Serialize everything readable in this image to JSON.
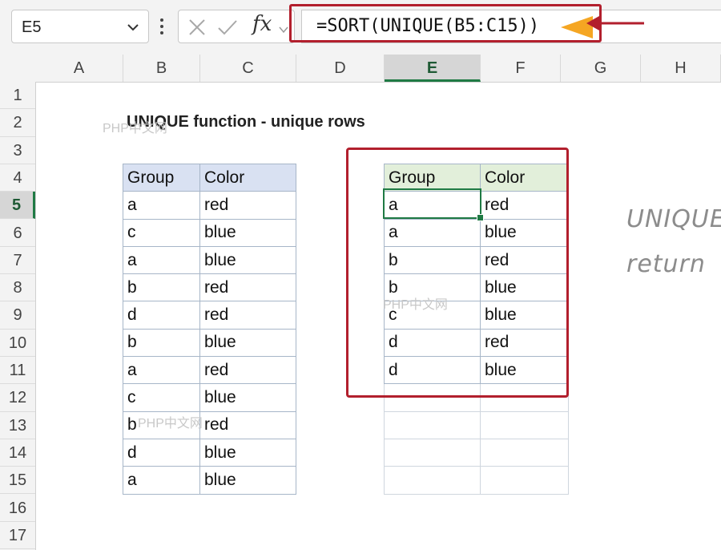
{
  "formula_bar": {
    "name_box": "E5",
    "formula": "=SORT(UNIQUE(B5:C15))",
    "fx_label": "fx"
  },
  "columns": [
    "A",
    "B",
    "C",
    "D",
    "E",
    "F",
    "G",
    "H"
  ],
  "selected_column": "E",
  "rows": [
    "1",
    "2",
    "3",
    "4",
    "5",
    "6",
    "7",
    "8",
    "9",
    "10",
    "11",
    "12",
    "13",
    "14",
    "15",
    "16",
    "17"
  ],
  "selected_row": "5",
  "sheet": {
    "title": "UNIQUE function - unique rows",
    "source_table": {
      "headers": [
        "Group",
        "Color"
      ],
      "rows": [
        [
          "a",
          "red"
        ],
        [
          "c",
          "blue"
        ],
        [
          "a",
          "blue"
        ],
        [
          "b",
          "red"
        ],
        [
          "d",
          "red"
        ],
        [
          "b",
          "blue"
        ],
        [
          "a",
          "red"
        ],
        [
          "c",
          "blue"
        ],
        [
          "b",
          "red"
        ],
        [
          "d",
          "blue"
        ],
        [
          "a",
          "blue"
        ]
      ]
    },
    "result_table": {
      "headers": [
        "Group",
        "Color"
      ],
      "rows": [
        [
          "a",
          "red"
        ],
        [
          "a",
          "blue"
        ],
        [
          "b",
          "red"
        ],
        [
          "b",
          "blue"
        ],
        [
          "c",
          "blue"
        ],
        [
          "d",
          "red"
        ],
        [
          "d",
          "blue"
        ]
      ],
      "empty_rows": 4
    },
    "note_lines": [
      "UNIQUE",
      "return"
    ]
  },
  "watermarks": [
    "PHP中文网",
    "PHP中文网",
    "PHP中文网"
  ],
  "colors": {
    "highlight_red": "#b21f2d",
    "arrow_orange": "#f5a623",
    "selection_green": "#1f7a44",
    "source_header_fill": "#d9e1f2",
    "result_header_fill": "#e2efda"
  },
  "icons": [
    "chevron-down-icon",
    "vertical-dots-icon",
    "cancel-x-icon",
    "confirm-check-icon",
    "fx-icon"
  ]
}
